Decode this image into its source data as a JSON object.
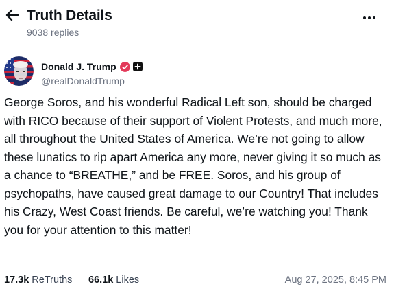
{
  "header": {
    "title": "Truth Details",
    "replies_count": "9038 replies",
    "back_icon": "arrow-left-icon",
    "more_icon": "more-horizontal-icon"
  },
  "author": {
    "name": "Donald J. Trump",
    "handle": "@realDonaldTrump",
    "verified_icon": "verified-check-icon",
    "badge_icon": "plus-badge-icon"
  },
  "post": {
    "text": "George Soros, and his wonderful Radical Left son, should be charged with RICO because of their support of Violent Protests, and much more, all throughout the United States of America. We’re not going to allow these lunatics to rip apart America any more, never giving it so much as a chance to “BREATHE,” and be FREE. Soros, and his group of psychopaths, have caused great damage to our Country! That includes his Crazy, West Coast friends. Be careful, we’re watching you! Thank you for your attention to this matter!"
  },
  "stats": {
    "retruths_count": "17.3k",
    "retruths_label": "ReTruths",
    "likes_count": "66.1k",
    "likes_label": "Likes",
    "timestamp": "Aug 27, 2025, 8:45 PM"
  },
  "colors": {
    "text": "#0f1419",
    "muted": "#6b7280",
    "verified": "#e33a5a",
    "badge": "#111111"
  }
}
